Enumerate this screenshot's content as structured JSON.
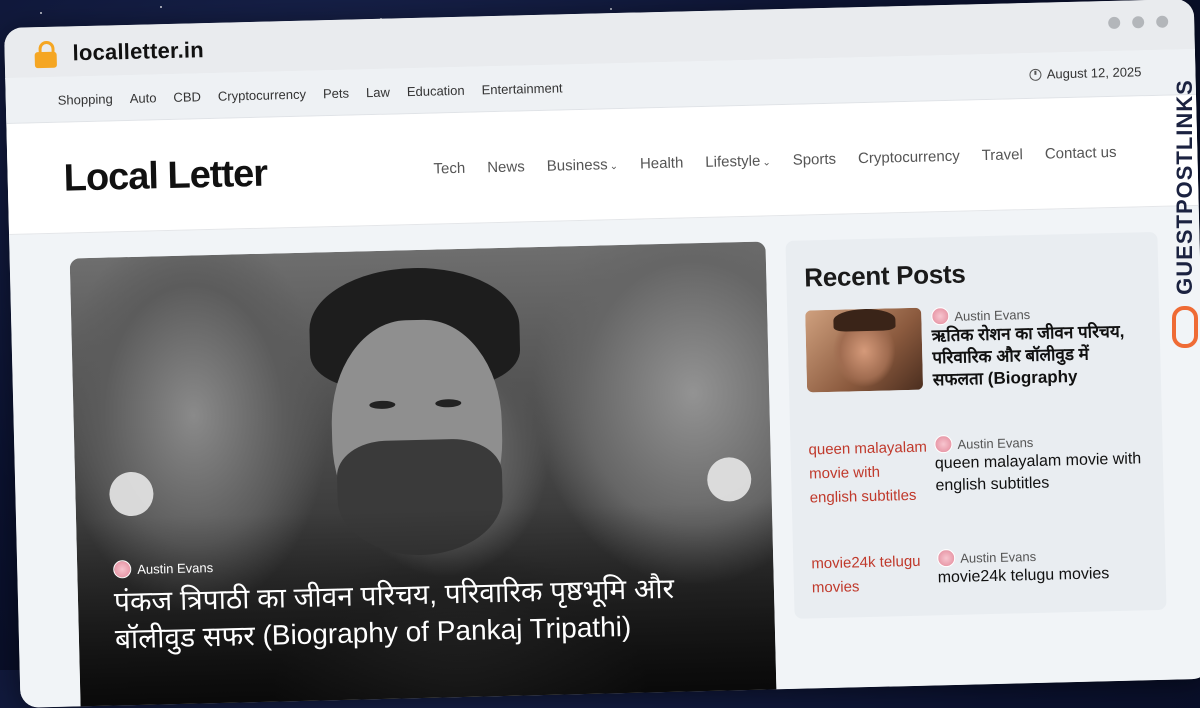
{
  "browser": {
    "url": "localletter.in"
  },
  "topbar": {
    "nav": [
      "Shopping",
      "Auto",
      "CBD",
      "Cryptocurrency",
      "Pets",
      "Law",
      "Education",
      "Entertainment"
    ],
    "date": "August 12, 2025"
  },
  "header": {
    "logo": "Local Letter",
    "nav": [
      {
        "label": "Tech"
      },
      {
        "label": "News"
      },
      {
        "label": "Business",
        "caret": "⌄"
      },
      {
        "label": "Health"
      },
      {
        "label": "Lifestyle",
        "caret": "⌄"
      },
      {
        "label": "Sports"
      },
      {
        "label": "Cryptocurrency"
      },
      {
        "label": "Travel"
      },
      {
        "label": "Contact us"
      }
    ]
  },
  "hero": {
    "author": "Austin Evans",
    "title": "पंकज त्रिपाठी का जीवन परिचय, परिवारिक पृष्ठभूमि और बॉलीवुड सफर (Biography of Pankaj Tripathi)"
  },
  "sidebar": {
    "heading": "Recent Posts",
    "posts": [
      {
        "author": "Austin Evans",
        "title": "ऋतिक रोशन का जीवन परिचय, परिवारिक और बॉलीवुड में सफलता (Biography"
      },
      {
        "author": "Austin Evans",
        "title": "queen malayalam movie with english subtitles",
        "alt": "queen malayalam movie with english subtitles"
      },
      {
        "author": "Austin Evans",
        "title": "movie24k telugu movies",
        "alt": "movie24k telugu movies"
      }
    ]
  },
  "watermark": {
    "text": "GUESTPOSTLINKS"
  }
}
